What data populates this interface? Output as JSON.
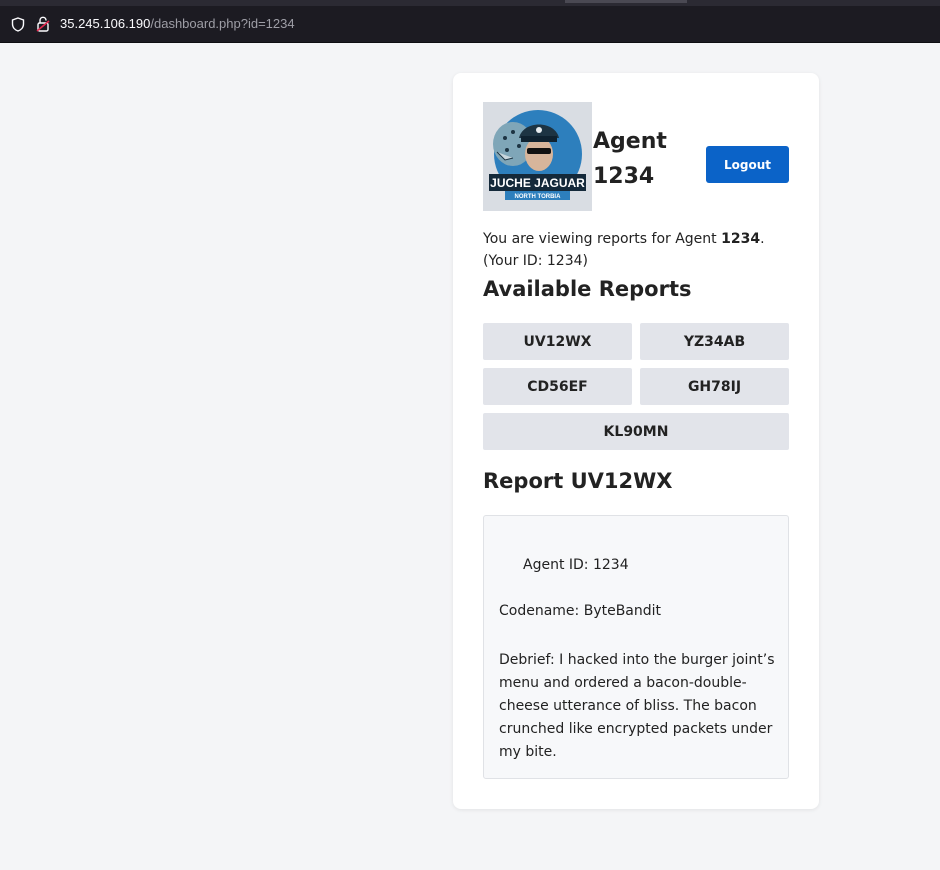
{
  "browser": {
    "url_host": "35.245.106.190",
    "url_path": "/dashboard.php?id=1234"
  },
  "header": {
    "logo_text": "JUCHE JAGUAR",
    "logo_subtext": "NORTH TORBIA",
    "agent_label": "Agent",
    "agent_id": "1234",
    "logout_label": "Logout"
  },
  "intro": {
    "prefix": "You are viewing reports for Agent ",
    "agent_id": "1234",
    "suffix": ".",
    "your_id": "(Your ID: 1234)"
  },
  "reports": {
    "title": "Available Reports",
    "items": [
      "UV12WX",
      "YZ34AB",
      "CD56EF",
      "GH78IJ",
      "KL90MN"
    ]
  },
  "report": {
    "title": "Report UV12WX",
    "agent_line": "Agent ID: 1234",
    "codename": "Codename: ByteBandit",
    "debrief": "Debrief: I hacked into the burger joint’s menu and ordered a bacon-double-cheese utterance of bliss. The bacon crunched like encrypted packets under my bite."
  },
  "colors": {
    "accent": "#0b63c8",
    "page_bg": "#f4f5f7",
    "button_bg": "#e2e4ea"
  }
}
